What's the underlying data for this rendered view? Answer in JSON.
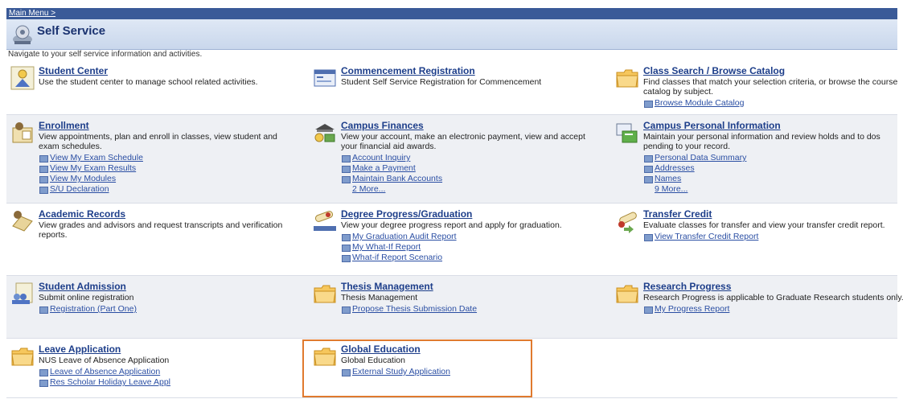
{
  "breadcrumb": {
    "main_menu": "Main Menu >"
  },
  "header": {
    "title": "Self Service"
  },
  "intro": "Navigate to your self service information and activities.",
  "rows": [
    [
      {
        "title": "Student Center",
        "desc": "Use the student center to manage school related activities.",
        "icon": "student-center-icon",
        "links": []
      },
      {
        "title": "Commencement Registration",
        "desc": "Student Self Service Registration for Commencement",
        "icon": "form-icon",
        "links": []
      },
      {
        "title": "Class Search / Browse Catalog",
        "desc": "Find classes that match your selection criteria, or browse the course catalog by subject.",
        "icon": "folder-icon",
        "links": [
          "Browse Module Catalog"
        ]
      }
    ],
    [
      {
        "title": "Enrollment",
        "desc": "View appointments, plan and enroll in classes, view student and exam schedules.",
        "icon": "enrollment-icon",
        "links": [
          "View My Exam Schedule",
          "View My Exam Results",
          "View My Modules",
          "S/U Declaration"
        ]
      },
      {
        "title": "Campus Finances",
        "desc": "View your account, make an electronic payment, view and accept your financial aid awards.",
        "icon": "finances-icon",
        "links": [
          "Account Inquiry",
          "Make a Payment",
          "Maintain Bank Accounts"
        ],
        "more": "2 More..."
      },
      {
        "title": "Campus Personal Information",
        "desc": "Maintain your personal information and review holds and to dos pending to your record.",
        "icon": "personal-info-icon",
        "links": [
          "Personal Data Summary",
          "Addresses",
          "Names"
        ],
        "more": "9 More..."
      }
    ],
    [
      {
        "title": "Academic Records",
        "desc": "View grades and advisors and request transcripts and verification reports.",
        "icon": "records-icon",
        "links": []
      },
      {
        "title": "Degree Progress/Graduation",
        "desc": "View your degree progress report and apply for graduation.",
        "icon": "degree-icon",
        "links": [
          "My Graduation Audit Report",
          "My What-If Report",
          "What-if Report Scenario"
        ]
      },
      {
        "title": "Transfer Credit",
        "desc": "Evaluate classes for transfer and view your transfer credit report.",
        "icon": "transfer-icon",
        "links": [
          "View Transfer Credit Report"
        ]
      }
    ],
    [
      {
        "title": "Student Admission",
        "desc": "Submit online registration",
        "icon": "admission-icon",
        "links": [
          "Registration (Part One)"
        ]
      },
      {
        "title": "Thesis Management",
        "desc": "Thesis Management",
        "icon": "folder-icon",
        "links": [
          "Propose Thesis Submission Date"
        ]
      },
      {
        "title": "Research Progress",
        "desc": "Research Progress is applicable to Graduate Research students only.",
        "icon": "folder-icon",
        "links": [
          "My Progress Report"
        ]
      }
    ],
    [
      {
        "title": "Leave Application",
        "desc": "NUS Leave of Absence Application",
        "icon": "folder-icon",
        "links": [
          "Leave of Absence Application",
          "Res Scholar Holiday Leave Appl"
        ]
      },
      {
        "title": "Global Education",
        "desc": "Global Education",
        "icon": "folder-icon",
        "links": [
          "External Study Application"
        ]
      }
    ]
  ]
}
